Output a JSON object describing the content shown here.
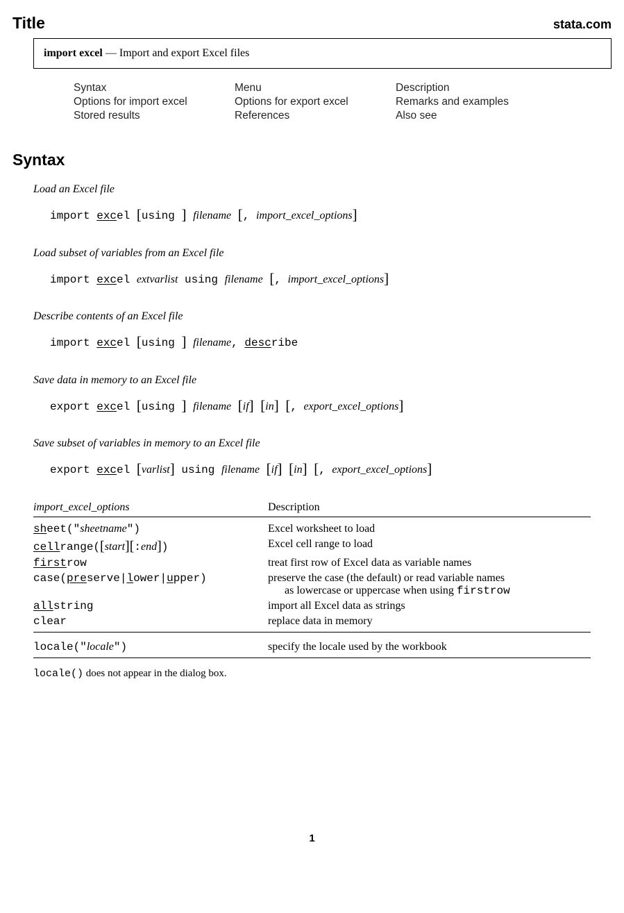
{
  "header": {
    "title": "Title",
    "site": "stata.com"
  },
  "title_box": {
    "command": "import excel",
    "sep": " — ",
    "desc": "Import and export Excel files"
  },
  "toc": {
    "r1c1": "Syntax",
    "r1c2": "Menu",
    "r1c3": "Description",
    "r2c1": "Options for import excel",
    "r2c2": "Options for export excel",
    "r2c3": "Remarks and examples",
    "r3c1": "Stored results",
    "r3c2": "References",
    "r3c3": "Also see"
  },
  "syntax": {
    "heading": "Syntax",
    "s1_desc": "Load an Excel file",
    "s2_desc": "Load subset of variables from an Excel file",
    "s3_desc": "Describe contents of an Excel file",
    "s4_desc": "Save data in memory to an Excel file",
    "s5_desc": "Save subset of variables in memory to an Excel file"
  },
  "cmd": {
    "import": "import ",
    "export": "export ",
    "exc": "exc",
    "el": "el ",
    "using_sp": "using ",
    "desc": "desc",
    "ribe": "ribe",
    "filename": "filename",
    "extvarlist": "extvarlist",
    "varlist": "varlist",
    "if": "if",
    "in": "in",
    "comma_sp": ", ",
    "import_excel_options": "import_excel_options",
    "export_excel_options": "export_excel_options"
  },
  "opts_table": {
    "h1": "import_excel_options",
    "h2": "Description",
    "sheet_ul": "sh",
    "sheet_rest": "eet(\"",
    "sheet_arg": "sheetname",
    "sheet_close": "\")",
    "sheet_desc": "Excel worksheet to load",
    "cell_ul": "cell",
    "cell_rest": "range(",
    "cell_start": "start",
    "cell_colon": ":",
    "cell_end": "end",
    "cell_close": ")",
    "cell_desc": "Excel cell range to load",
    "first_ul": "first",
    "first_rest": "row",
    "first_desc": "treat first row of Excel data as variable names",
    "case_pre": "case(",
    "case_pre_ul": "pre",
    "case_serve": "serve",
    "case_bar1": "|",
    "case_l": "l",
    "case_ower": "ower",
    "case_bar2": "|",
    "case_u": "u",
    "case_pper": "pper",
    "case_close": ")",
    "case_desc1": "preserve the case (the default) or read variable names",
    "case_desc2": "as lowercase or uppercase when using ",
    "case_desc_tt": "firstrow",
    "all_ul": "all",
    "all_rest": "string",
    "all_desc": "import all Excel data as strings",
    "clear": "clear",
    "clear_desc": "replace data in memory",
    "locale_pre": "locale(\"",
    "locale_arg": "locale",
    "locale_close": "\")",
    "locale_desc": "specify the locale used by the workbook"
  },
  "footnote": {
    "tt": "locale()",
    "rest": " does not appear in the dialog box."
  },
  "page_num": "1"
}
